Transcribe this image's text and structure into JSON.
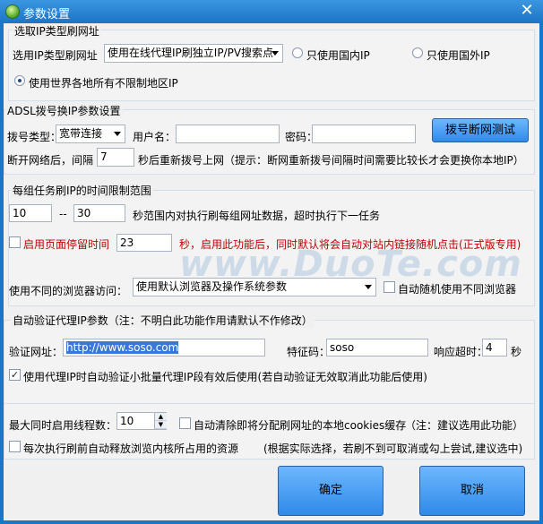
{
  "window": {
    "title": "参数设置",
    "close_label": "✕"
  },
  "group_url": {
    "title": "选取IP类型刷网址",
    "type_label": "选用IP类型刷网址",
    "type_select": "使用在线代理IP刷独立IP/PV搜索点",
    "radio_domestic": "只使用国内IP",
    "radio_foreign": "只使用国外IP",
    "radio_all": "使用世界各地所有不限制地区IP"
  },
  "group_adsl": {
    "title": "ADSL拨号换IP参数设置",
    "dial_type_label": "拨号类型：",
    "dial_type_value": "宽带连接",
    "username_label": "用户名：",
    "username_value": "",
    "password_label": "密码：",
    "password_value": "",
    "test_button": "拨号断网测试",
    "disconnect_prefix": "断开网络后，间隔",
    "interval_value": "7",
    "disconnect_suffix": "秒后重新拨号上网（提示：断网重新拨号间隔时间需要比较长才会更换你本地IP）"
  },
  "group_time": {
    "title": "每组任务刷IP的时间限制范围",
    "min_value": "10",
    "dash": "--",
    "max_value": "30",
    "range_text": "秒范围内对执行刷每组网址数据，超时执行下一任务",
    "stay_label": "启用页面停留时间",
    "stay_value": "23",
    "stay_note": "秒，启用此功能后，同时默认将会自动对站内链接随机点击(正式版专用)",
    "browser_label": "使用不同的浏览器访问：",
    "browser_select": "使用默认浏览器及操作系统参数",
    "random_browser": "自动随机使用不同浏览器"
  },
  "group_verify": {
    "title": "自动验证代理IP参数（注：不明白此功能作用请默认不作修改）",
    "url_label": "验证网址：",
    "url_value": "http://www.soso.com",
    "code_label": "特征码：",
    "code_value": "soso",
    "timeout_label": "响应超时：",
    "timeout_value": "4",
    "timeout_unit": "秒",
    "auto_verify": "使用代理IP时自动验证小批量代理IP段有效后使用(若自动验证无效取消此功能后使用)"
  },
  "group_misc": {
    "threads_label": "最大同时启用线程数：",
    "threads_value": "10",
    "clear_cookies": "自动清除即将分配刷网址的本地cookies缓存",
    "clear_note": "（注：建议选用此功能）",
    "release_resources": "每次执行刷前自动释放浏览内核所占用的资源",
    "release_note": "(根据实际选择，若刷不到可取消或勾上尝试,建议选中)"
  },
  "buttons": {
    "ok": "确定",
    "cancel": "取消"
  },
  "watermark": "www.DuoTe.com",
  "colors": {
    "titlebar": "#1c74c6",
    "accent_button": "#2f8ae8",
    "warning_text": "#c00000"
  }
}
